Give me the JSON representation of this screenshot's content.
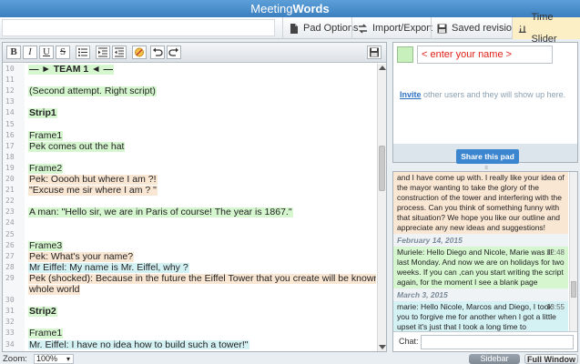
{
  "app": {
    "title_part1": "Meeting",
    "title_part2": "Words"
  },
  "topbar": {
    "pad_options": "Pad Options",
    "import_export": "Import/Export",
    "saved_revisions": "Saved revisions",
    "time_slider": "Time Slider"
  },
  "editor": {
    "lines": [
      {
        "num": "10",
        "text": "— ► TEAM 1 ◄ —",
        "style": "green bold"
      },
      {
        "num": "11",
        "text": "",
        "style": ""
      },
      {
        "num": "12",
        "text": "(Second attempt. Right script)",
        "style": "green"
      },
      {
        "num": "13",
        "text": "",
        "style": ""
      },
      {
        "num": "14",
        "text": "Strip1",
        "style": "green bold"
      },
      {
        "num": "15",
        "text": "",
        "style": ""
      },
      {
        "num": "16",
        "text": "Frame1",
        "style": "green"
      },
      {
        "num": "17",
        "text": "Pek comes out the hat",
        "style": "green"
      },
      {
        "num": "18",
        "text": "",
        "style": ""
      },
      {
        "num": "19",
        "text": "Frame2",
        "style": "green"
      },
      {
        "num": "20",
        "text": "Pek: Ooooh but where I am ?!",
        "style": "peach"
      },
      {
        "num": "21",
        "text": " \"Excuse me sir where I am ? \"",
        "style": "peach"
      },
      {
        "num": "22",
        "text": "",
        "style": ""
      },
      {
        "num": "23",
        "text": " A man: \"Hello sir, we are in Paris of course! The year is 1867.\"",
        "style": "green"
      },
      {
        "num": "24",
        "text": "",
        "style": ""
      },
      {
        "num": "25",
        "text": "",
        "style": ""
      },
      {
        "num": "26",
        "text": "Frame3",
        "style": "green"
      },
      {
        "num": "27",
        "text": "Pek: What's your name?",
        "style": "peach"
      },
      {
        "num": "28",
        "text": "Mr Eiffel: My name is Mr. Eiffel, why ?",
        "style": "blue"
      },
      {
        "num": "29",
        "text": "Pek (shocked): Because in the future the Eiffel Tower that you create will be known to the",
        "style": "peach"
      },
      {
        "num": "",
        "text": "whole world",
        "style": "peach"
      },
      {
        "num": "30",
        "text": "",
        "style": ""
      },
      {
        "num": "31",
        "text": "Strip2",
        "style": "green bold"
      },
      {
        "num": "32",
        "text": "",
        "style": ""
      },
      {
        "num": "33",
        "text": "Frame1",
        "style": "green"
      },
      {
        "num": "34",
        "text": "Mr. Eiffel: I have no idea how to build such a tower!\"",
        "style": "blue"
      }
    ]
  },
  "users": {
    "name_placeholder": "< enter your name >",
    "invite_link": "Invite",
    "invite_text": " other users and they will show up here.",
    "share_button": "Share this pad",
    "my_color": "#c7f0bd"
  },
  "chat": {
    "messages": [
      {
        "type": "msg",
        "color": "peach",
        "time": "",
        "text": "and I have come up with. I really like your idea of the mayor wanting to take the glory of the construction of the tower and interfering with the process. Can you think of something funny with that situation? We hope you like our outline and appreciate any new ideas and suggestions!"
      },
      {
        "type": "date",
        "text": "February 14, 2015"
      },
      {
        "type": "msg",
        "color": "green",
        "time": "12:48",
        "text": "Muriele: Hello Diego and Nicole, Marie was ill last Monday. And now we are on holidays for two weeks. If you can ,can you start writing the script again, for the moment I see a blank page"
      },
      {
        "type": "date",
        "text": "March 3, 2015"
      },
      {
        "type": "msg",
        "color": "blue",
        "time": "13:55",
        "text": "marie: Hello Nicole, Marcos and Diego, I took you to forgive me for another when I got a little upset it's just that I took a long time to"
      }
    ],
    "input_label": "Chat:"
  },
  "bottombar": {
    "zoom_label": "Zoom:",
    "zoom_value": "100%",
    "sidebar_button": "Sidebar",
    "fullwindow_button": "Full Window"
  }
}
